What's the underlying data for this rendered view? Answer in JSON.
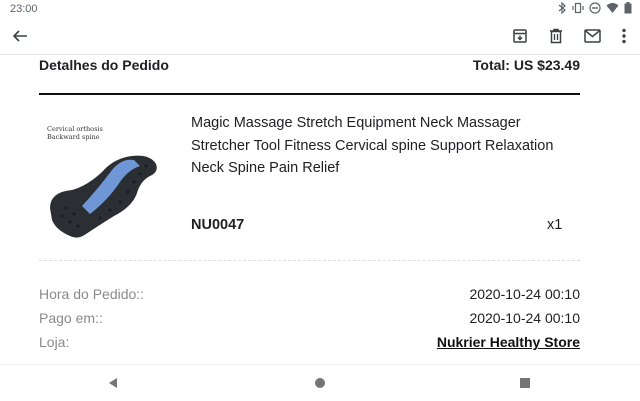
{
  "status_bar": {
    "time": "23:00",
    "icons": [
      "bluetooth-icon",
      "vibrate-icon",
      "do-not-disturb-icon",
      "wifi-icon",
      "battery-icon"
    ]
  },
  "app_bar": {
    "icons": [
      "back-arrow-icon",
      "archive-icon",
      "delete-icon",
      "mail-icon",
      "more-vert-icon"
    ]
  },
  "order": {
    "title": "Detalhes do Pedido",
    "total": "Total: US $23.49",
    "product": {
      "image_caption_line1": "Cervical orthosis",
      "image_caption_line2": "Backward spine",
      "name": "Magic Massage Stretch Equipment Neck Massager Stretcher Tool Fitness Cervical spine Support Relaxation Neck Spine Pain Relief",
      "sku": "NU0047",
      "quantity": "x1"
    },
    "details": [
      {
        "label": "Hora do Pedido::",
        "value": "2020-10-24 00:10"
      },
      {
        "label": "Pago em::",
        "value": "2020-10-24 00:10"
      },
      {
        "label": "Loja:",
        "value": "Nukrier Healthy Store"
      }
    ]
  },
  "colors": {
    "accent_blue": "#6f97d6",
    "product_black": "#2b2f33",
    "label_gray": "#8a8a8a",
    "nav_gray": "#757575"
  },
  "nav_bar": {
    "icons": [
      "nav-back-icon",
      "nav-home-icon",
      "nav-recents-icon"
    ]
  }
}
